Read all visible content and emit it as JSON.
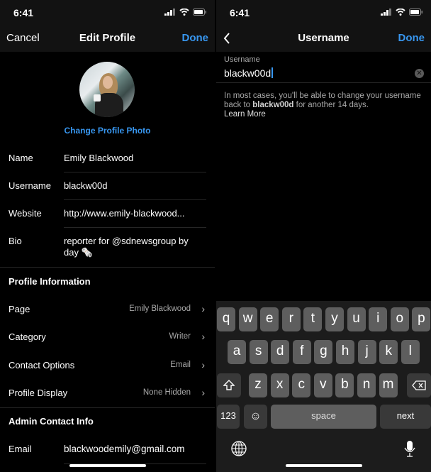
{
  "status": {
    "time": "6:41"
  },
  "left": {
    "nav": {
      "cancel": "Cancel",
      "title": "Edit Profile",
      "done": "Done"
    },
    "change_photo": "Change Profile Photo",
    "fields": [
      {
        "label": "Name",
        "value": "Emily Blackwood"
      },
      {
        "label": "Username",
        "value": "blackw00d"
      },
      {
        "label": "Website",
        "value": "http://www.emily-blackwood..."
      },
      {
        "label": "Bio",
        "value": "reporter for @sdnewsgroup by day 🗞️"
      }
    ],
    "profile_info": {
      "heading": "Profile Information",
      "rows": [
        {
          "label": "Page",
          "value": "Emily Blackwood"
        },
        {
          "label": "Category",
          "value": "Writer"
        },
        {
          "label": "Contact Options",
          "value": "Email"
        },
        {
          "label": "Profile Display",
          "value": "None Hidden"
        }
      ]
    },
    "admin": {
      "heading": "Admin Contact Info",
      "email_label": "Email",
      "email_value": "blackwoodemily@gmail.com"
    }
  },
  "right": {
    "nav": {
      "title": "Username",
      "done": "Done"
    },
    "field_label": "Username",
    "field_value": "blackw00d",
    "hint_pre": "In most cases, you'll be able to change your username back to ",
    "hint_bold": "blackw00d",
    "hint_post": " for another 14 days.",
    "learn_more": "Learn More",
    "keyboard": {
      "row1": [
        "q",
        "w",
        "e",
        "r",
        "t",
        "y",
        "u",
        "i",
        "o",
        "p"
      ],
      "row2": [
        "a",
        "s",
        "d",
        "f",
        "g",
        "h",
        "j",
        "k",
        "l"
      ],
      "row3": [
        "z",
        "x",
        "c",
        "v",
        "b",
        "n",
        "m"
      ],
      "numbers": "123",
      "space": "space",
      "next": "next"
    }
  },
  "colors": {
    "accent": "#3897f0",
    "background": "#000000",
    "bar": "#121212"
  }
}
